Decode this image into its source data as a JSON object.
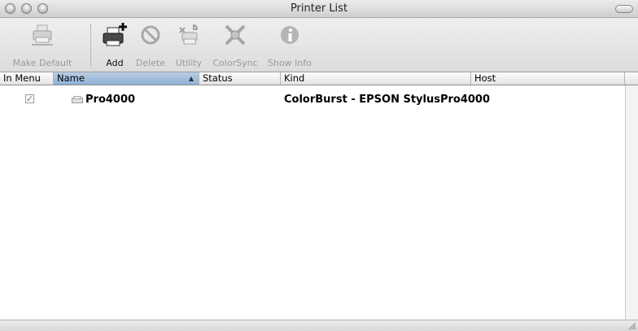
{
  "window": {
    "title": "Printer List"
  },
  "toolbar": {
    "items": [
      {
        "label": "Make Default",
        "icon": "printer-default-icon",
        "enabled": false
      },
      {
        "label": "Add",
        "icon": "add-printer-icon",
        "enabled": true
      },
      {
        "label": "Delete",
        "icon": "delete-icon",
        "enabled": false
      },
      {
        "label": "Utility",
        "icon": "utility-icon",
        "enabled": false
      },
      {
        "label": "ColorSync",
        "icon": "colorsync-icon",
        "enabled": false
      },
      {
        "label": "Show Info",
        "icon": "info-icon",
        "enabled": false
      }
    ]
  },
  "columns": [
    {
      "label": "In Menu",
      "sorted": false
    },
    {
      "label": "Name",
      "sorted": true,
      "sort_direction": "ascending"
    },
    {
      "label": "Status",
      "sorted": false
    },
    {
      "label": "Kind",
      "sorted": false
    },
    {
      "label": "Host",
      "sorted": false
    }
  ],
  "printers": [
    {
      "in_menu": true,
      "name": "Pro4000",
      "status": "",
      "kind": "ColorBurst - EPSON StylusPro4000",
      "host": ""
    }
  ],
  "colors": {
    "sorted_header": "#9bb9dc"
  }
}
